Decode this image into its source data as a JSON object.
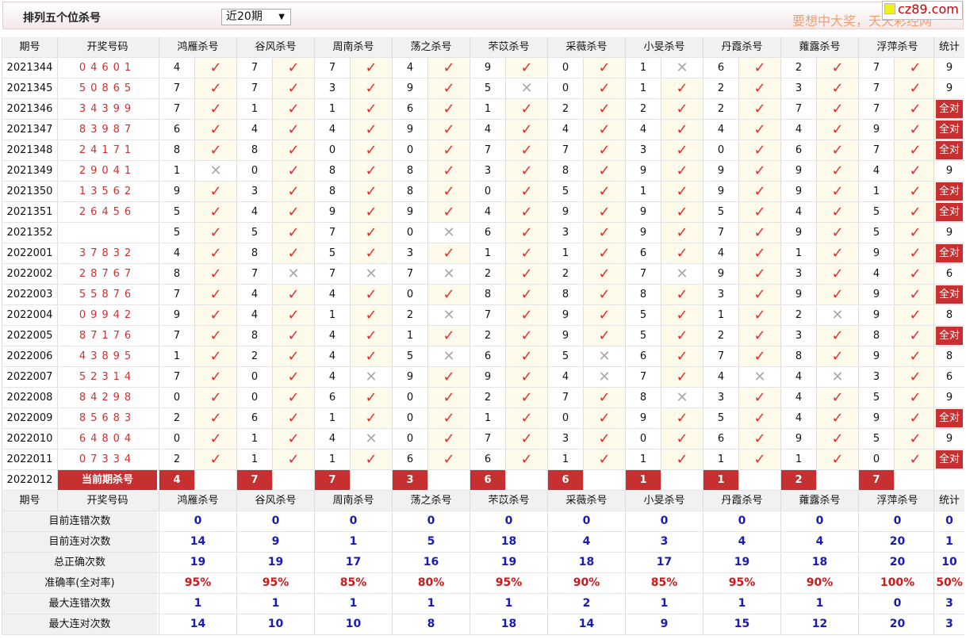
{
  "header": {
    "title": "排列五个位杀号",
    "period_select": "近20期",
    "slogan": "要想中大奖，天天彩经网",
    "logo": "cz89.com"
  },
  "table": {
    "col_period": "期号",
    "col_draw": "开奖号码",
    "experts": [
      "鸿雁杀号",
      "谷风杀号",
      "周南杀号",
      "荡之杀号",
      "芣苡杀号",
      "采薇杀号",
      "小旻杀号",
      "丹霞杀号",
      "蕹露杀号",
      "浮萍杀号"
    ],
    "col_stat": "统计",
    "all_right_label": "全对",
    "rows": [
      {
        "period": "2021344",
        "draw": "04601",
        "kills": [
          "4",
          "7",
          "7",
          "4",
          "9",
          "0",
          "1",
          "6",
          "2",
          "7"
        ],
        "hits": [
          1,
          1,
          1,
          1,
          1,
          1,
          0,
          1,
          1,
          1
        ],
        "stat": "9"
      },
      {
        "period": "2021345",
        "draw": "50865",
        "kills": [
          "7",
          "7",
          "3",
          "9",
          "5",
          "0",
          "1",
          "2",
          "3",
          "7"
        ],
        "hits": [
          1,
          1,
          1,
          1,
          0,
          1,
          1,
          1,
          1,
          1
        ],
        "stat": "9"
      },
      {
        "period": "2021346",
        "draw": "34399",
        "kills": [
          "7",
          "1",
          "1",
          "6",
          "1",
          "2",
          "2",
          "2",
          "7",
          "7"
        ],
        "hits": [
          1,
          1,
          1,
          1,
          1,
          1,
          1,
          1,
          1,
          1
        ],
        "stat": "全对"
      },
      {
        "period": "2021347",
        "draw": "83987",
        "kills": [
          "6",
          "4",
          "4",
          "9",
          "4",
          "4",
          "4",
          "4",
          "4",
          "9"
        ],
        "hits": [
          1,
          1,
          1,
          1,
          1,
          1,
          1,
          1,
          1,
          1
        ],
        "stat": "全对"
      },
      {
        "period": "2021348",
        "draw": "24171",
        "kills": [
          "8",
          "8",
          "0",
          "0",
          "7",
          "7",
          "3",
          "0",
          "6",
          "7"
        ],
        "hits": [
          1,
          1,
          1,
          1,
          1,
          1,
          1,
          1,
          1,
          1
        ],
        "stat": "全对"
      },
      {
        "period": "2021349",
        "draw": "29041",
        "kills": [
          "1",
          "0",
          "8",
          "8",
          "3",
          "8",
          "9",
          "9",
          "9",
          "4"
        ],
        "hits": [
          0,
          1,
          1,
          1,
          1,
          1,
          1,
          1,
          1,
          1
        ],
        "stat": "9"
      },
      {
        "period": "2021350",
        "draw": "13562",
        "kills": [
          "9",
          "3",
          "8",
          "8",
          "0",
          "5",
          "1",
          "9",
          "9",
          "1"
        ],
        "hits": [
          1,
          1,
          1,
          1,
          1,
          1,
          1,
          1,
          1,
          1
        ],
        "stat": "全对"
      },
      {
        "period": "2021351",
        "draw": "26456",
        "kills": [
          "5",
          "4",
          "9",
          "9",
          "4",
          "9",
          "9",
          "5",
          "4",
          "5"
        ],
        "hits": [
          1,
          1,
          1,
          1,
          1,
          1,
          1,
          1,
          1,
          1
        ],
        "stat": "全对"
      },
      {
        "period": "2021352",
        "draw": "",
        "kills": [
          "5",
          "5",
          "7",
          "0",
          "6",
          "3",
          "9",
          "7",
          "9",
          "5"
        ],
        "hits": [
          1,
          1,
          1,
          0,
          1,
          1,
          1,
          1,
          1,
          1
        ],
        "stat": "9"
      },
      {
        "period": "2022001",
        "draw": "37832",
        "kills": [
          "4",
          "8",
          "5",
          "3",
          "1",
          "1",
          "6",
          "4",
          "1",
          "9"
        ],
        "hits": [
          1,
          1,
          1,
          1,
          1,
          1,
          1,
          1,
          1,
          1
        ],
        "stat": "全对"
      },
      {
        "period": "2022002",
        "draw": "28767",
        "kills": [
          "8",
          "7",
          "7",
          "7",
          "2",
          "2",
          "7",
          "9",
          "3",
          "4"
        ],
        "hits": [
          1,
          0,
          0,
          0,
          1,
          1,
          0,
          1,
          1,
          1
        ],
        "stat": "6"
      },
      {
        "period": "2022003",
        "draw": "55876",
        "kills": [
          "7",
          "4",
          "4",
          "0",
          "8",
          "8",
          "8",
          "3",
          "9",
          "9"
        ],
        "hits": [
          1,
          1,
          1,
          1,
          1,
          1,
          1,
          1,
          1,
          1
        ],
        "stat": "全对"
      },
      {
        "period": "2022004",
        "draw": "09942",
        "kills": [
          "9",
          "4",
          "1",
          "2",
          "7",
          "9",
          "5",
          "1",
          "2",
          "9"
        ],
        "hits": [
          1,
          1,
          1,
          0,
          1,
          1,
          1,
          1,
          0,
          1
        ],
        "stat": "8"
      },
      {
        "period": "2022005",
        "draw": "87176",
        "kills": [
          "7",
          "8",
          "4",
          "1",
          "2",
          "9",
          "5",
          "2",
          "3",
          "8"
        ],
        "hits": [
          1,
          1,
          1,
          1,
          1,
          1,
          1,
          1,
          1,
          1
        ],
        "stat": "全对"
      },
      {
        "period": "2022006",
        "draw": "43895",
        "kills": [
          "1",
          "2",
          "4",
          "5",
          "6",
          "5",
          "6",
          "7",
          "8",
          "9"
        ],
        "hits": [
          1,
          1,
          1,
          0,
          1,
          0,
          1,
          1,
          1,
          1
        ],
        "stat": "8"
      },
      {
        "period": "2022007",
        "draw": "52314",
        "kills": [
          "7",
          "0",
          "4",
          "9",
          "9",
          "4",
          "7",
          "4",
          "4",
          "3"
        ],
        "hits": [
          1,
          1,
          0,
          1,
          1,
          0,
          1,
          0,
          0,
          1
        ],
        "stat": "6"
      },
      {
        "period": "2022008",
        "draw": "84298",
        "kills": [
          "0",
          "0",
          "6",
          "0",
          "2",
          "7",
          "8",
          "3",
          "4",
          "5"
        ],
        "hits": [
          1,
          1,
          1,
          1,
          1,
          1,
          0,
          1,
          1,
          1
        ],
        "stat": "9"
      },
      {
        "period": "2022009",
        "draw": "85683",
        "kills": [
          "2",
          "6",
          "1",
          "0",
          "1",
          "0",
          "9",
          "5",
          "4",
          "9"
        ],
        "hits": [
          1,
          1,
          1,
          1,
          1,
          1,
          1,
          1,
          1,
          1
        ],
        "stat": "全对"
      },
      {
        "period": "2022010",
        "draw": "64804",
        "kills": [
          "0",
          "1",
          "4",
          "0",
          "7",
          "3",
          "0",
          "6",
          "9",
          "5"
        ],
        "hits": [
          1,
          1,
          0,
          1,
          1,
          1,
          1,
          1,
          1,
          1
        ],
        "stat": "9"
      },
      {
        "period": "2022011",
        "draw": "07334",
        "kills": [
          "2",
          "1",
          "1",
          "6",
          "6",
          "1",
          "1",
          "1",
          "1",
          "0"
        ],
        "hits": [
          1,
          1,
          1,
          1,
          1,
          1,
          1,
          1,
          1,
          1
        ],
        "stat": "全对"
      }
    ],
    "current": {
      "period": "2022012",
      "label": "当前期杀号",
      "kills": [
        "4",
        "7",
        "7",
        "3",
        "6",
        "6",
        "1",
        "1",
        "2",
        "7"
      ]
    },
    "stats": [
      {
        "label": "目前连错次数",
        "values": [
          "0",
          "0",
          "0",
          "0",
          "0",
          "0",
          "0",
          "0",
          "0",
          "0"
        ],
        "stat": "0",
        "color": "blue"
      },
      {
        "label": "目前连对次数",
        "values": [
          "14",
          "9",
          "1",
          "5",
          "18",
          "4",
          "3",
          "4",
          "4",
          "20"
        ],
        "stat": "1",
        "color": "blue"
      },
      {
        "label": "总正确次数",
        "values": [
          "19",
          "19",
          "17",
          "16",
          "19",
          "18",
          "17",
          "19",
          "18",
          "20"
        ],
        "stat": "10",
        "color": "blue"
      },
      {
        "label": "准确率(全对率)",
        "values": [
          "95%",
          "95%",
          "85%",
          "80%",
          "95%",
          "90%",
          "85%",
          "95%",
          "90%",
          "100%"
        ],
        "stat": "50%",
        "color": "red"
      },
      {
        "label": "最大连错次数",
        "values": [
          "1",
          "1",
          "1",
          "1",
          "1",
          "2",
          "1",
          "1",
          "1",
          "0"
        ],
        "stat": "3",
        "color": "blue"
      },
      {
        "label": "最大连对次数",
        "values": [
          "14",
          "10",
          "10",
          "8",
          "18",
          "14",
          "9",
          "15",
          "12",
          "20"
        ],
        "stat": "3",
        "color": "blue"
      }
    ]
  }
}
